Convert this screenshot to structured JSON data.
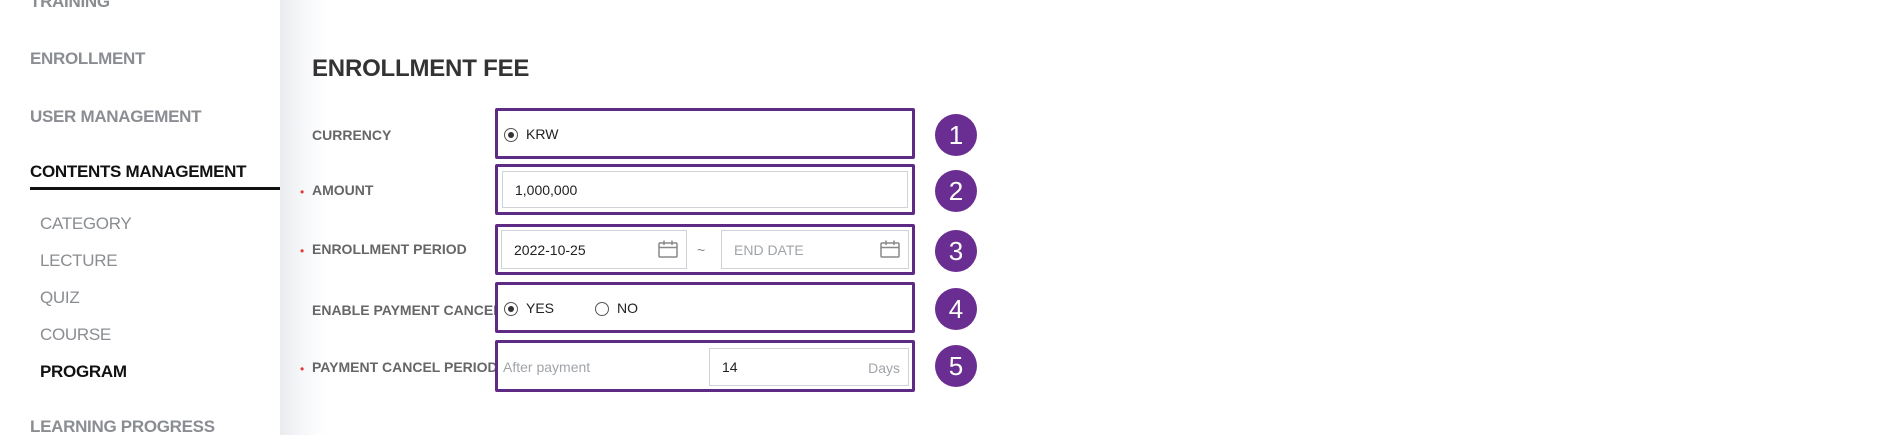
{
  "sidebar": {
    "training_label": "TRAINING",
    "enrollment_label": "ENROLLMENT",
    "user_management_label": "USER MANAGEMENT",
    "contents_management_label": "CONTENTS MANAGEMENT",
    "sub_items": [
      "CATEGORY",
      "LECTURE",
      "QUIZ",
      "COURSE",
      "PROGRAM"
    ],
    "active_sub_item": "PROGRAM",
    "learning_progress_label": "LEARNING PROGRESS"
  },
  "main": {
    "title": "ENROLLMENT FEE",
    "currency": {
      "label": "CURRENCY",
      "option": "KRW"
    },
    "amount": {
      "label": "AMOUNT",
      "required_mark": "•",
      "value": "1,000,000"
    },
    "enrollment_period": {
      "label": "ENROLLMENT PERIOD",
      "required_mark": "•",
      "start_value": "2022-10-25",
      "separator": "~",
      "end_placeholder": "END DATE"
    },
    "enable_payment_cancel": {
      "label": "ENABLE PAYMENT CANCEL",
      "yes_label": "YES",
      "no_label": "NO",
      "selected": "YES"
    },
    "payment_cancel_period": {
      "label": "PAYMENT CANCEL PERIOD",
      "required_mark": "•",
      "prefix": "After payment",
      "value": "14",
      "unit": "Days"
    }
  },
  "badges": [
    "1",
    "2",
    "3",
    "4",
    "5"
  ],
  "colors": {
    "highlight": "#5e2a84",
    "badge": "#6a2d91",
    "required": "#e53935",
    "active_nav": "#111111",
    "muted_nav": "#8a8d91"
  }
}
